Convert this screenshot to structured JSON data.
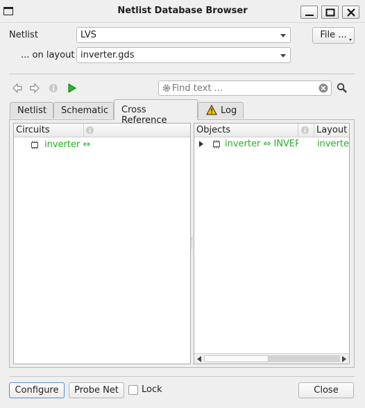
{
  "window": {
    "title": "Netlist Database Browser"
  },
  "form": {
    "netlist_label": "Netlist",
    "netlist_value": "LVS",
    "layout_label": "... on layout",
    "layout_value": "inverter.gds",
    "file_button": "File ..."
  },
  "search": {
    "placeholder": "Find text ..."
  },
  "tabs": [
    {
      "label": "Netlist"
    },
    {
      "label": "Schematic"
    },
    {
      "label": "Cross Reference"
    },
    {
      "label": "Log"
    }
  ],
  "circuits": {
    "header": "Circuits",
    "rows": [
      {
        "text": "inverter ⇔"
      }
    ]
  },
  "objects": {
    "headers": [
      "Objects",
      "Layout"
    ],
    "rows": [
      {
        "object": "inverter ⇔ INVERT",
        "layout": "inverter"
      }
    ]
  },
  "bottom": {
    "configure": "Configure",
    "probe_net": "Probe Net",
    "lock": "Lock",
    "close": "Close"
  },
  "colors": {
    "match_green": "#22b022",
    "play_green": "#22bb22",
    "warning_yellow": "#f5c400"
  }
}
